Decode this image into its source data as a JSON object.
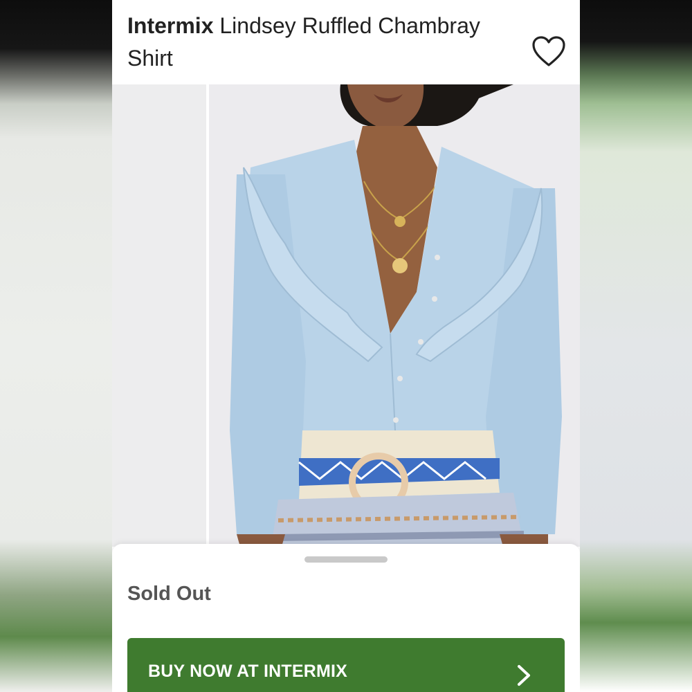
{
  "product": {
    "brand": "Intermix",
    "name": " Lindsey Ruffled Chambray Shirt"
  },
  "icons": {
    "favorite": "heart-outline-icon",
    "buy_arrow": "chevron-right-icon"
  },
  "sheet": {
    "status": "Sold Out",
    "buy_label": "BUY NOW AT INTERMIX"
  },
  "colors": {
    "buy_button": "#3f7b2f",
    "shirt": "#b9d3e8"
  }
}
